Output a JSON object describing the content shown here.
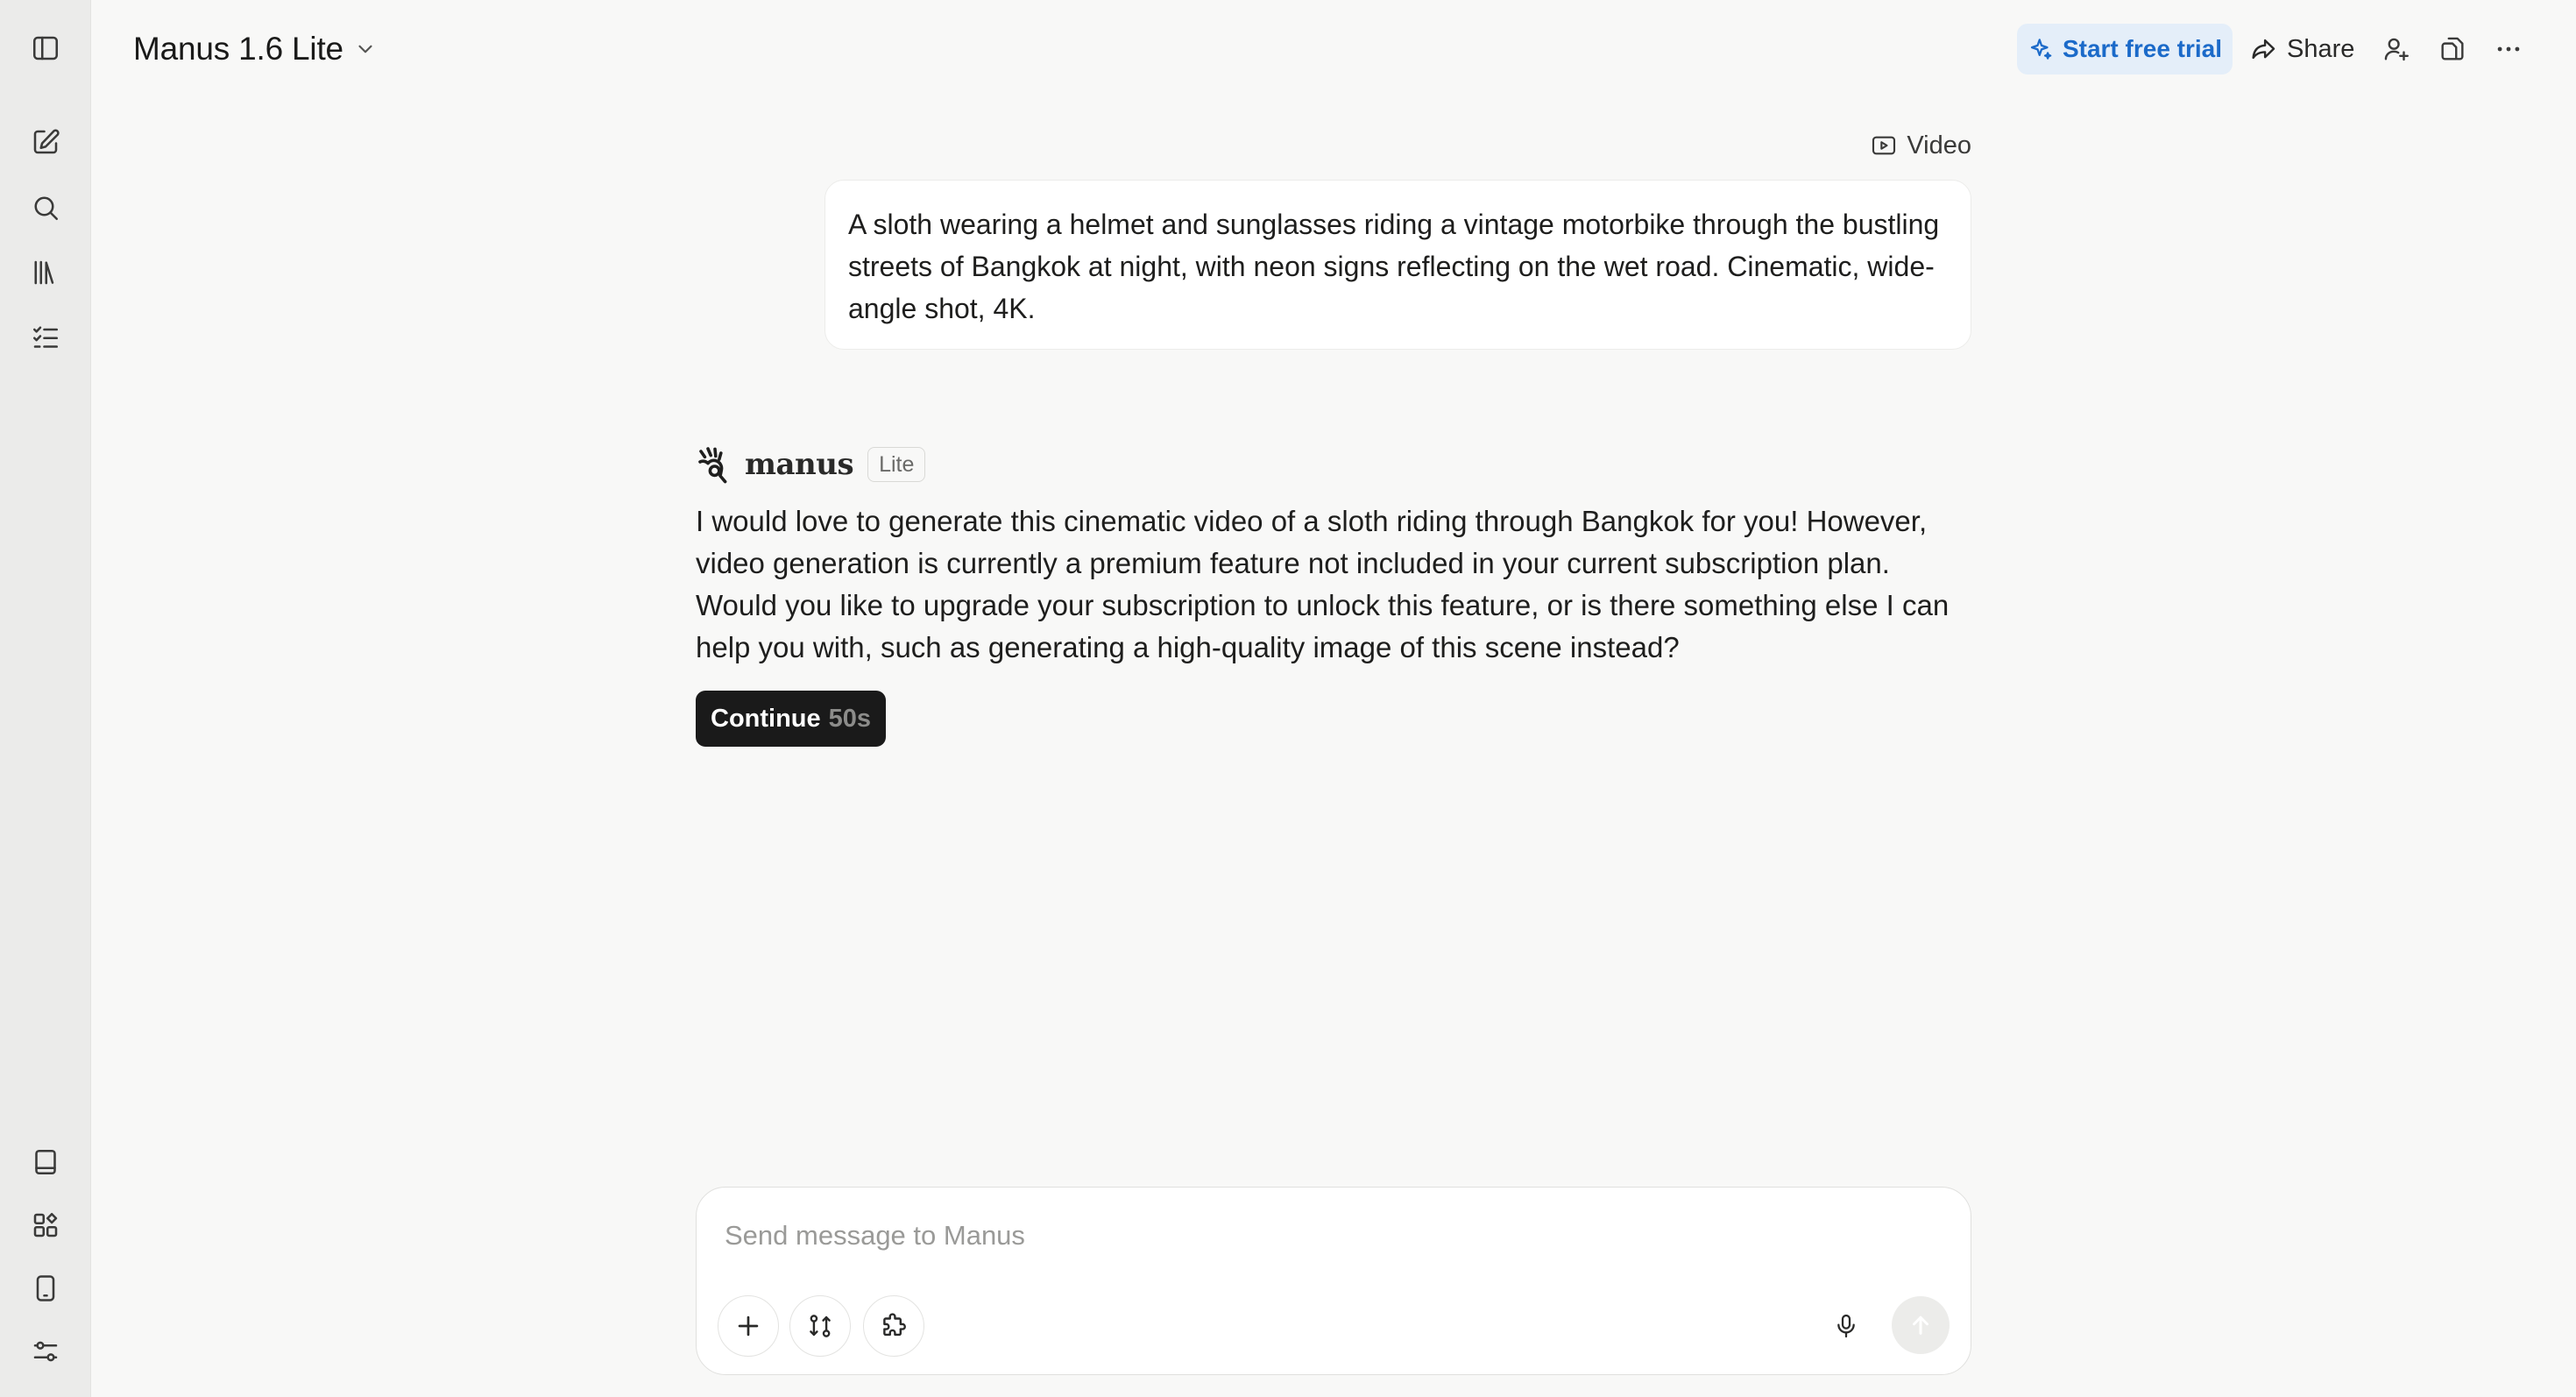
{
  "sidebar": {
    "items": [
      {
        "name": "toggle-sidebar",
        "icon": "panel-left-icon"
      },
      {
        "name": "new-task",
        "icon": "edit-icon"
      },
      {
        "name": "search",
        "icon": "search-icon"
      },
      {
        "name": "library",
        "icon": "library-icon"
      },
      {
        "name": "tasks",
        "icon": "checklist-icon"
      }
    ],
    "bottom_items": [
      {
        "name": "knowledge",
        "icon": "book-icon"
      },
      {
        "name": "apps",
        "icon": "apps-grid-icon"
      },
      {
        "name": "mobile",
        "icon": "phone-icon"
      },
      {
        "name": "settings",
        "icon": "sliders-icon"
      }
    ]
  },
  "header": {
    "model": "Manus 1.6 Lite",
    "trial_label": "Start free trial",
    "share_label": "Share"
  },
  "conversation": {
    "user_tool_tag": "Video",
    "user_message": "A sloth wearing a helmet and sunglasses riding a vintage motorbike through the bustling streets of Bangkok at night, with neon signs reflecting on the wet road. Cinematic, wide-angle shot, 4K.",
    "assistant_name": "manus",
    "assistant_badge": "Lite",
    "assistant_message": "I would love to generate this cinematic video of a sloth riding through Bangkok for you! However, video generation is currently a premium feature not included in your current subscription plan. Would you like to upgrade your subscription to unlock this feature, or is there something else I can help you with, such as generating a high-quality image of this scene instead?",
    "continue_label": "Continue",
    "continue_timer": "50s"
  },
  "composer": {
    "placeholder": "Send message to Manus",
    "value": ""
  },
  "colors": {
    "accent": "#1b6ac9",
    "trial_bg": "#e4eef9",
    "sidebar_bg": "#ebebea",
    "page_bg": "#f8f8f7",
    "button_dark": "#1a1a1a"
  }
}
